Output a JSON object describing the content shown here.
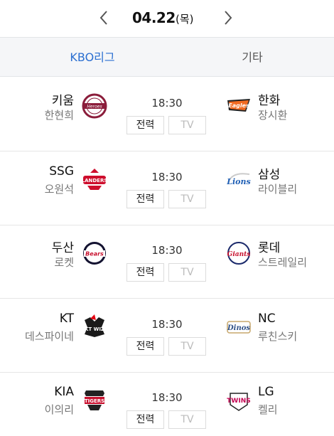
{
  "date": {
    "text": "04.22",
    "weekday": "(목)"
  },
  "tabs": [
    {
      "label": "KBO리그",
      "active": true
    },
    {
      "label": "기타",
      "active": false
    }
  ],
  "buttons": {
    "lineup": "전력",
    "tv": "TV"
  },
  "colors": {
    "accent": "#2b6fd1"
  },
  "games": [
    {
      "time": "18:30",
      "away": {
        "team": "키움",
        "pitcher": "한현희",
        "logo": "heroes-logo",
        "color": "#8b1d3b"
      },
      "home": {
        "team": "한화",
        "pitcher": "장시환",
        "logo": "eagles-logo",
        "color": "#f26a21"
      }
    },
    {
      "time": "18:30",
      "away": {
        "team": "SSG",
        "pitcher": "오원석",
        "logo": "landers-logo",
        "color": "#ce0e2d"
      },
      "home": {
        "team": "삼성",
        "pitcher": "라이블리",
        "logo": "lions-logo",
        "color": "#1f5fb5"
      }
    },
    {
      "time": "18:30",
      "away": {
        "team": "두산",
        "pitcher": "로켓",
        "logo": "bears-logo",
        "color": "#131230"
      },
      "home": {
        "team": "롯데",
        "pitcher": "스트레일리",
        "logo": "giants-logo",
        "color": "#c8102e"
      }
    },
    {
      "time": "18:30",
      "away": {
        "team": "KT",
        "pitcher": "데스파이네",
        "logo": "kt-wiz-logo",
        "color": "#1a1a1a"
      },
      "home": {
        "team": "NC",
        "pitcher": "루친스키",
        "logo": "dinos-logo",
        "color": "#315288"
      }
    },
    {
      "time": "18:30",
      "away": {
        "team": "KIA",
        "pitcher": "이의리",
        "logo": "tigers-logo",
        "color": "#c8102e"
      },
      "home": {
        "team": "LG",
        "pitcher": "켈리",
        "logo": "twins-logo",
        "color": "#c30452"
      }
    }
  ]
}
